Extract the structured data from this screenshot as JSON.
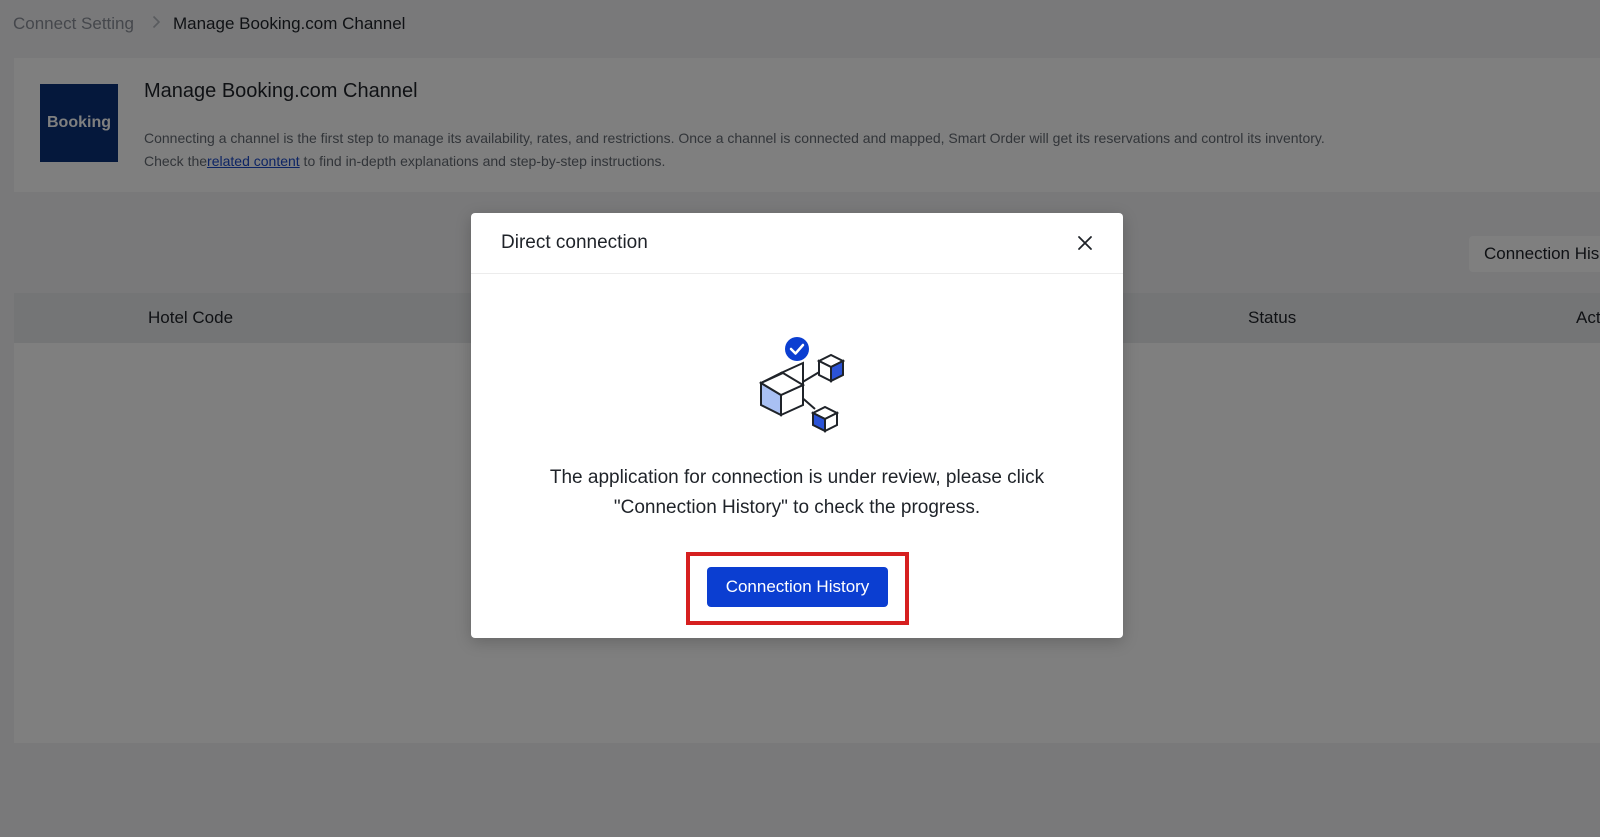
{
  "breadcrumb": {
    "parent": "Connect Setting",
    "separator": ">",
    "current": "Manage Booking.com Channel"
  },
  "channel_card": {
    "logo_text": "Booking",
    "title": "Manage Booking.com Channel",
    "description_line1": "Connecting a channel is the first step to manage its availability, rates, and restrictions. Once a channel is connected and mapped, Smart Order will get its reservations and control its inventory.",
    "description_prefix": "Check the",
    "related_link": "related content",
    "description_suffix": " to find in-depth explanations and step-by-step instructions."
  },
  "toolbar": {
    "connection_history_label": "Connection His"
  },
  "table": {
    "columns": [
      "Hotel Code",
      "Status",
      "Act"
    ]
  },
  "modal": {
    "title": "Direct connection",
    "close_icon": "close-icon",
    "illustration_icon": "connected-cubes-check-icon",
    "message_line1": "The application for connection is under review, please click",
    "message_line2": "\"Connection History\" to check the progress.",
    "primary_button": "Connection History"
  },
  "colors": {
    "brand_navy": "#0b3179",
    "primary_blue": "#0b3ed1",
    "highlight_red": "#d61f1f",
    "link_blue": "#1a49c8"
  }
}
